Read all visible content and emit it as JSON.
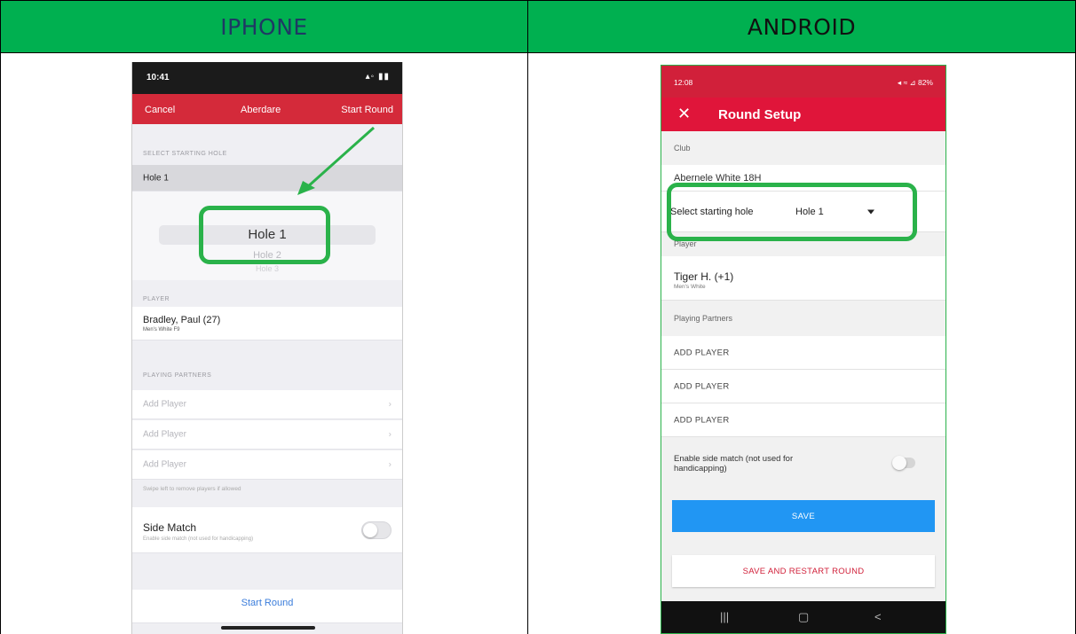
{
  "table": {
    "header_left": "IPHONE",
    "header_right": "ANDROID"
  },
  "iphone": {
    "status_time": "10:41",
    "status_icons": "▴◦ ▮▮",
    "nav": {
      "cancel": "Cancel",
      "title": "Aberdare",
      "start": "Start Round"
    },
    "section_starting_hole": "SELECT STARTING HOLE",
    "selected_hole": "Hole 1",
    "picker": {
      "selected": "Hole 1",
      "next1": "Hole 2",
      "next2": "Hole 3"
    },
    "section_player": "PLAYER",
    "player": {
      "name": "Bradley, Paul (27)",
      "tee": "Men's White F9"
    },
    "section_partners": "PLAYING PARTNERS",
    "add_player": [
      "Add Player",
      "Add Player",
      "Add Player"
    ],
    "swipe_hint": "Swipe left to remove players if allowed",
    "side_match": {
      "title": "Side Match",
      "subtitle": "Enable side match (not used for handicapping)",
      "on": false
    },
    "bottom_button": "Start Round"
  },
  "android": {
    "status_time": "12:08",
    "status_icons": "◂ ≈ ⊿ 82%",
    "title": "Round Setup",
    "section_club": "Club",
    "club_value": "Abernele White 18H",
    "starting_hole_label": "Select starting hole",
    "starting_hole_value": "Hole 1",
    "section_player": "Player",
    "player": {
      "name": "Tiger H. (+1)",
      "tee": "Men's White"
    },
    "section_partners": "Playing Partners",
    "add_player": [
      "ADD PLAYER",
      "ADD PLAYER",
      "ADD PLAYER"
    ],
    "side_match_label": "Enable side match (not used for handicapping)",
    "side_match_on": false,
    "save_label": "SAVE",
    "restart_label": "SAVE AND RESTART ROUND",
    "nav": {
      "recents": "|||",
      "home": "▢",
      "back": "<"
    }
  },
  "colors": {
    "header_green": "#00b050",
    "ios_red": "#d42a3a",
    "android_red": "#e0153a",
    "highlight_green": "#2ab24a",
    "save_blue": "#2196f3"
  }
}
